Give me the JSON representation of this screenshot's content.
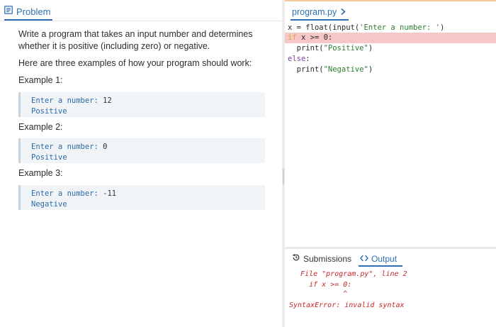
{
  "problem_tab": {
    "label": "Problem",
    "icon": "document-icon"
  },
  "description": {
    "line1": "Write a program that takes an input number and determines",
    "line2": "whether it is positive (including zero) or negative.",
    "intro": "Here are three examples of how your program should work:"
  },
  "examples": [
    {
      "heading": "Example 1:",
      "prompt": "Enter a number:",
      "input": "12",
      "output": "Positive"
    },
    {
      "heading": "Example 2:",
      "prompt": "Enter a number:",
      "input": "0",
      "output": "Positive"
    },
    {
      "heading": "Example 3:",
      "prompt": "Enter a number:",
      "input": "-11",
      "output": "Negative"
    }
  ],
  "editor": {
    "file_tab": "program.py",
    "code": {
      "l1_var": "x = ",
      "l1_fn": "float(input(",
      "l1_str": "'Enter a number: '",
      "l1_end": ")",
      "l2_kw": "if",
      "l2_rest": " x >= 0:",
      "l3_indent": "  ",
      "l3_fn": "print(",
      "l3_str": "\"Positive\"",
      "l3_end": ")",
      "l4_kw": "else",
      "l4_rest": ":",
      "l5_indent": "  ",
      "l5_fn": "print(",
      "l5_str": "\"Negative\"",
      "l5_end": ")"
    }
  },
  "bottom_tabs": {
    "submissions": "Submissions",
    "output": "Output"
  },
  "output": {
    "line1": "  File \"program.py\", line 2",
    "line2": "    if x >= 0:",
    "line3": "            ^",
    "line4": "SyntaxError: invalid syntax"
  },
  "colors": {
    "accent": "#2f6fb3",
    "error_highlight": "#f6c7c7",
    "error_text": "#c62828",
    "example_bg": "#f1f4f7"
  }
}
